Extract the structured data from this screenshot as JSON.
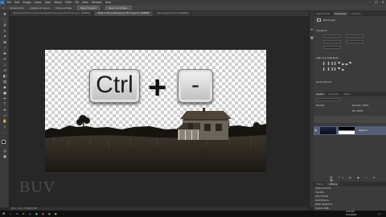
{
  "menubar": {
    "app_icon": "Ps",
    "items": [
      "File",
      "Edit",
      "Image",
      "Layer",
      "Type",
      "Select",
      "Filter",
      "3D",
      "View",
      "Window",
      "Help"
    ]
  },
  "options_bar": {
    "sample_size": "Sample Size:",
    "sample_all": "Sample All Layers",
    "enhance_edge": "Enhance Edge",
    "select_subject": "Select Subject",
    "select_mask": "Select and Mask..."
  },
  "tabs": [
    {
      "label": "Abandoned Home clip art transparent-bg.psd @ 24.9% (Group 1, RGB/8#)",
      "active": false
    },
    {
      "label": "Night on the prairie.jpg @ 33% (Layer 0, RGB/8#)",
      "active": true
    },
    {
      "label": "Clouds.jpg @ 33.3% (RGB/8#)",
      "active": false
    }
  ],
  "keys": {
    "ctrl": "Ctrl",
    "plus": "+",
    "minus": "-"
  },
  "watermark": "BUV",
  "statusbar": {
    "zoom": "33%",
    "doc": "Doc: 7.64M/13.0M"
  },
  "panels": {
    "top_tabs": [
      "Adjustments",
      "Properties",
      "Libraries"
    ],
    "pixel_layer": "Pixel Layer",
    "transform": "Transform",
    "align": "Align and Distribute",
    "quick_actions": "Quick Actions",
    "layers_tabs": [
      "Layers",
      "Channels",
      "Paths"
    ],
    "blend_mode": "Normal",
    "opacity": "Opacity: 100%",
    "fill": "Fill: 100%",
    "layer_name": "Layer 0",
    "bottom_tabs": [
      "History",
      "Actions"
    ],
    "history": [
      "Default Actions",
      "Vignette",
      "Wood Frame",
      "Cast Shadow",
      "Water Reflection",
      "Custom RGB..."
    ]
  },
  "taskbar": {
    "time": "4:19 PM",
    "date": "5/12/2020"
  },
  "colors": {
    "accent": "#2a5f8e",
    "panel": "#3b3b3b",
    "canvas_bg": "#272727"
  }
}
